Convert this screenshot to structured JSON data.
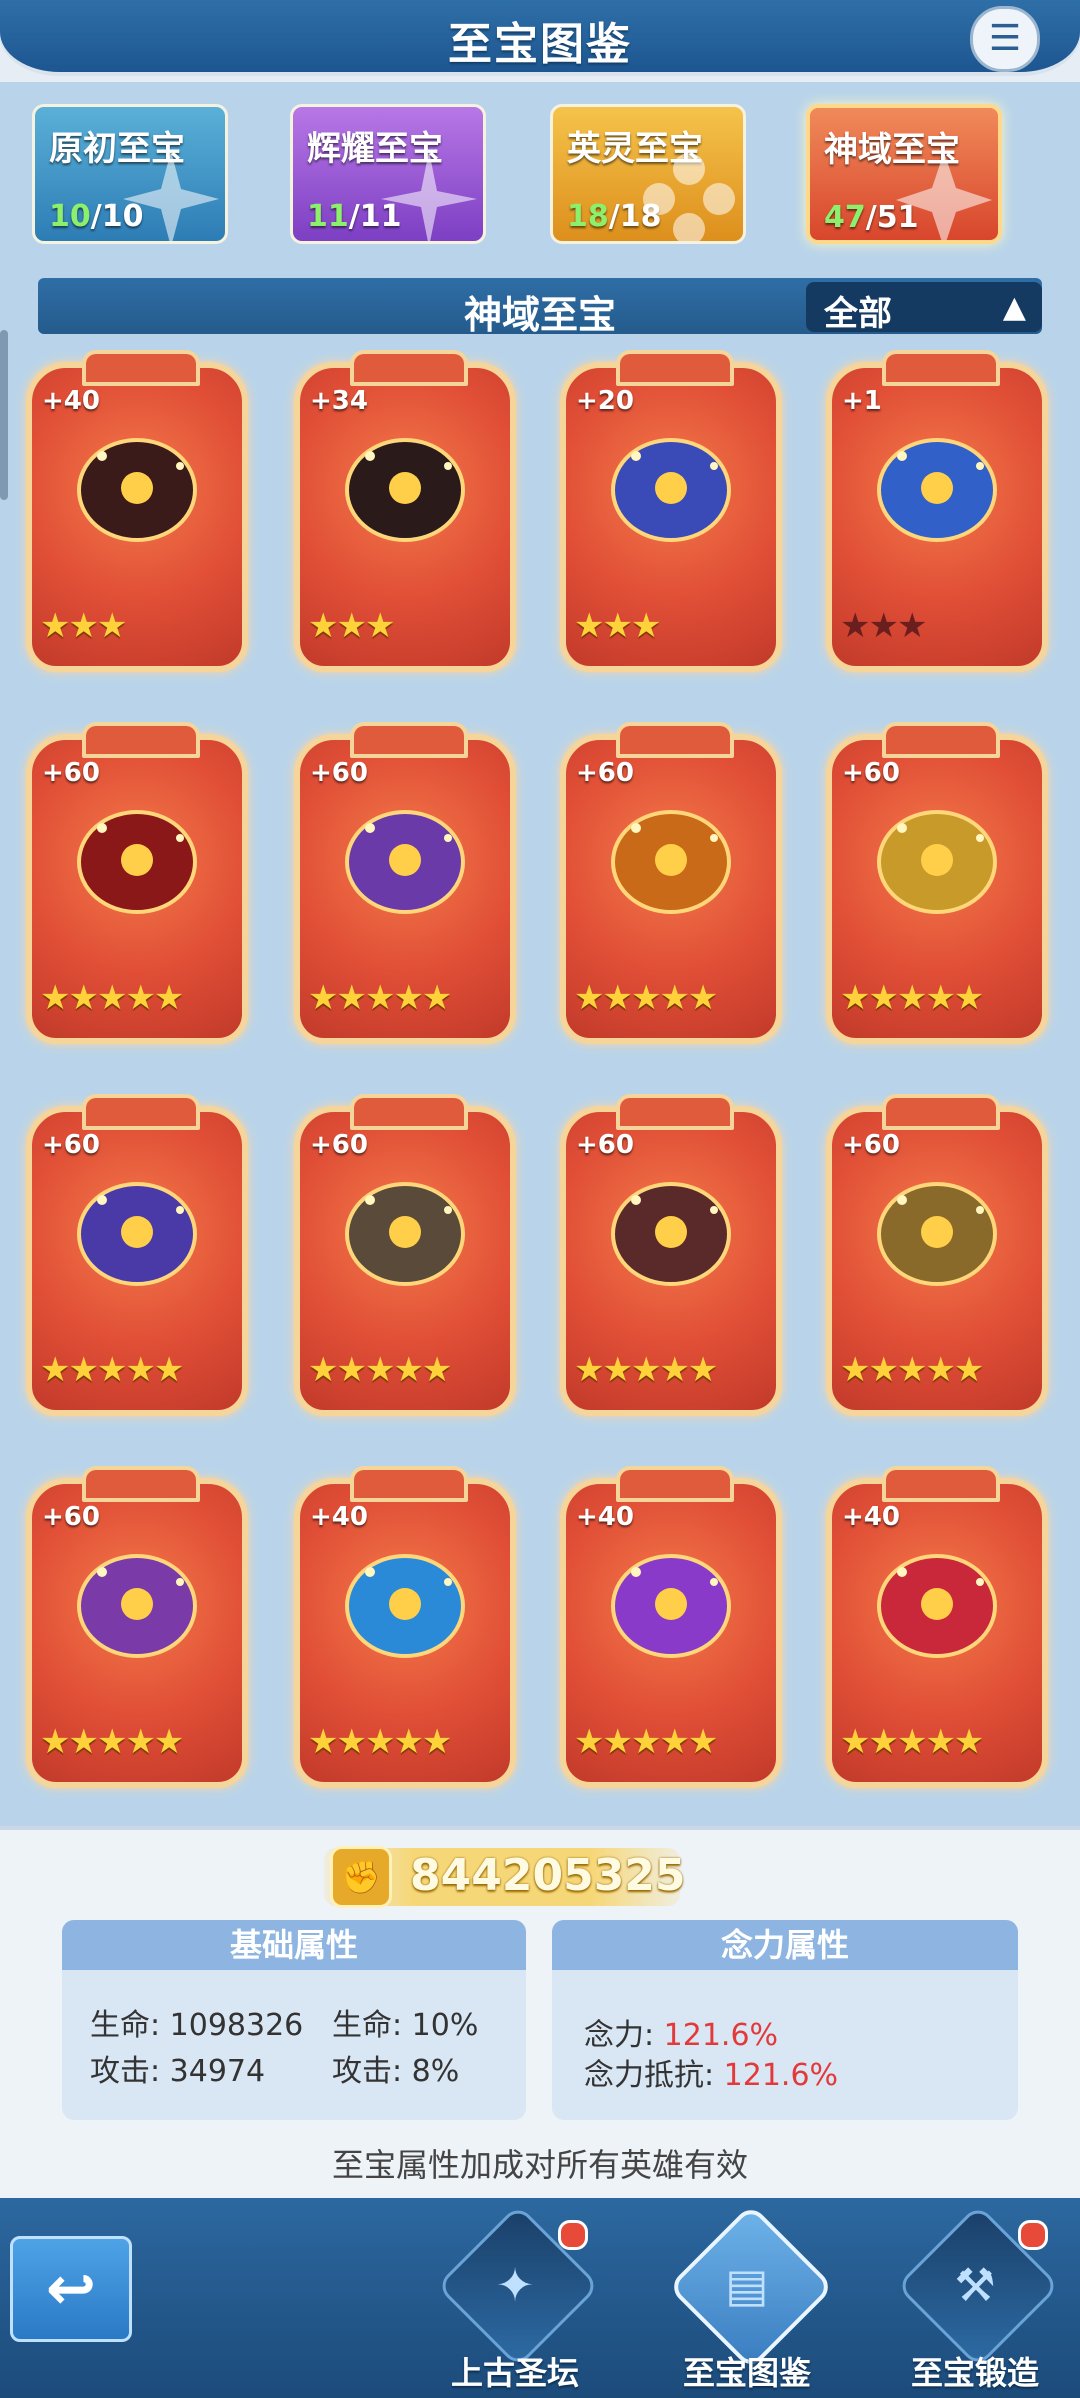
{
  "header": {
    "title": "至宝图鉴",
    "menu_icon": "list-icon"
  },
  "categories": [
    {
      "name": "原初至宝",
      "got": "10",
      "total": "/10",
      "icon": "compass-star-icon"
    },
    {
      "name": "辉耀至宝",
      "got": "11",
      "total": "/11",
      "icon": "sparkle-star-icon"
    },
    {
      "name": "英灵至宝",
      "got": "18",
      "total": "/18",
      "icon": "flower-star-icon"
    },
    {
      "name": "神域至宝",
      "got": "47",
      "total": "/51",
      "icon": "divine-star-icon"
    }
  ],
  "section": {
    "title": "神域至宝",
    "filter": "全部",
    "filter_icon": "triangle-up-icon"
  },
  "items": [
    {
      "level": "+40",
      "stars": "★★★",
      "art": "flaming-maces"
    },
    {
      "level": "+34",
      "stars": "★★★",
      "art": "fire-crown"
    },
    {
      "level": "+20",
      "stars": "★★★",
      "art": "jeweled-umbrella"
    },
    {
      "level": "+1",
      "stars": "★★★",
      "art": "feather-fan"
    },
    {
      "level": "+60",
      "stars": "★★★★★",
      "art": "spiked-band"
    },
    {
      "level": "+60",
      "stars": "★★★★★",
      "art": "purple-gauntlet"
    },
    {
      "level": "+60",
      "stars": "★★★★★",
      "art": "fire-claw"
    },
    {
      "level": "+60",
      "stars": "★★★★★",
      "art": "golden-cube"
    },
    {
      "level": "+60",
      "stars": "★★★★★",
      "art": "astral-disc"
    },
    {
      "level": "+60",
      "stars": "★★★★★",
      "art": "sword-in-stone"
    },
    {
      "level": "+60",
      "stars": "★★★★★",
      "art": "hanging-cauldron"
    },
    {
      "level": "+60",
      "stars": "★★★★★",
      "art": "steam-engine"
    },
    {
      "level": "+60",
      "stars": "★★★★★",
      "art": "magic-teapot"
    },
    {
      "level": "+40",
      "stars": "★★★★★",
      "art": "winged-shield"
    },
    {
      "level": "+40",
      "stars": "★★★★★",
      "art": "purple-horn"
    },
    {
      "level": "+40",
      "stars": "★★★★★",
      "art": "royal-crown"
    }
  ],
  "power": {
    "value": "844205325",
    "icon": "fist-icon"
  },
  "base_attrs": {
    "title": "基础属性",
    "hp_label": "生命:",
    "hp_value": "1098326",
    "hp_pct_label": "生命:",
    "hp_pct_value": "10%",
    "atk_label": "攻击:",
    "atk_value": "34974",
    "atk_pct_label": "攻击:",
    "atk_pct_value": "8%"
  },
  "mind_attrs": {
    "title": "念力属性",
    "mind_label": "念力:",
    "mind_value": "121.6%",
    "resist_label": "念力抵抗:",
    "resist_value": "121.6%"
  },
  "note": "至宝属性加成对所有英雄有效",
  "nav": {
    "back_icon": "back-arrow-icon",
    "items": [
      {
        "label": "上古圣坛",
        "icon": "altar-icon"
      },
      {
        "label": "至宝图鉴",
        "icon": "book-icon"
      },
      {
        "label": "至宝锻造",
        "icon": "forge-icon"
      }
    ]
  },
  "colors": {
    "accent_blue": "#2f6fa8",
    "card_red": "#e04e36",
    "star_gold": "#ffd23c",
    "value_red": "#e23a3a"
  }
}
